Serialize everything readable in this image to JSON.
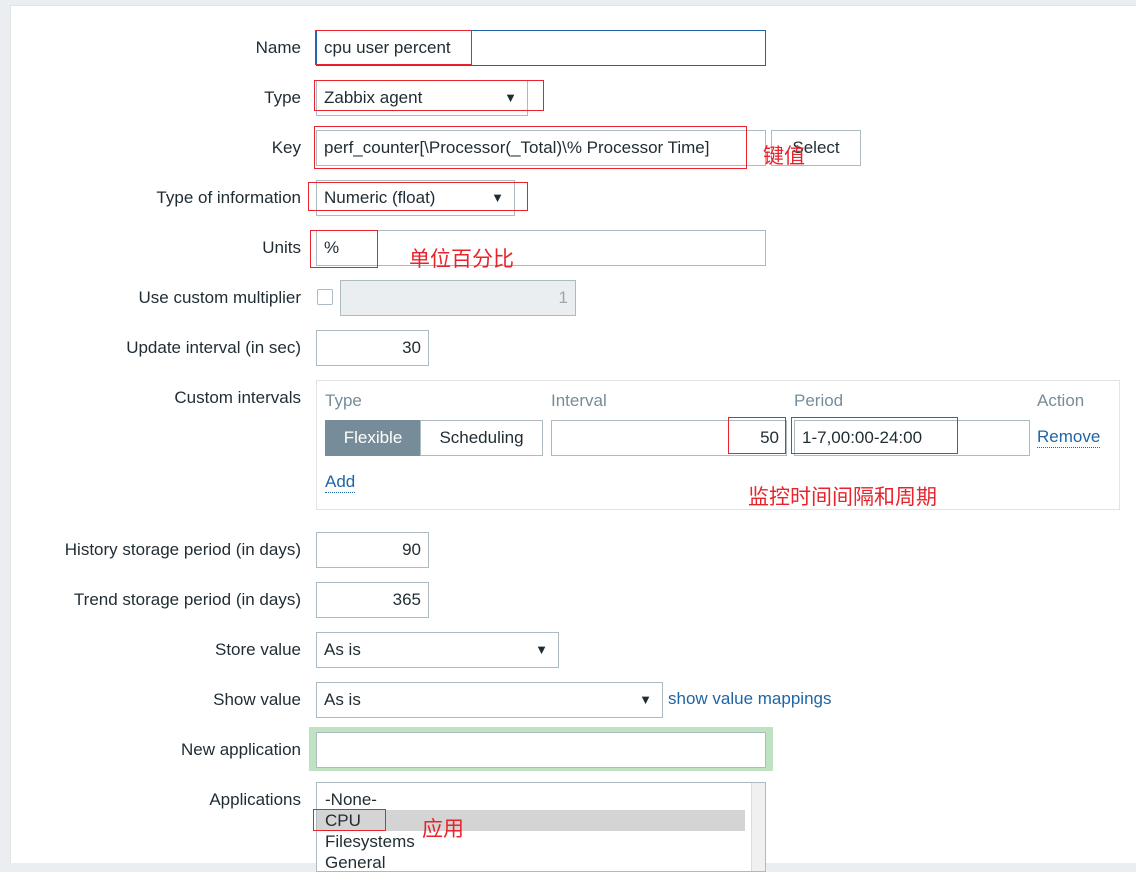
{
  "form": {
    "name": {
      "label": "Name",
      "value": "cpu user percent"
    },
    "type": {
      "label": "Type",
      "value": "Zabbix agent"
    },
    "key": {
      "label": "Key",
      "value": "perf_counter[\\Processor(_Total)\\% Processor Time]",
      "select_label": "Select"
    },
    "type_of_information": {
      "label": "Type of information",
      "value": "Numeric (float)"
    },
    "units": {
      "label": "Units",
      "value": "%"
    },
    "custom_multiplier": {
      "label": "Use custom multiplier",
      "checked": false,
      "value": "1"
    },
    "update_interval": {
      "label": "Update interval (in sec)",
      "value": "30"
    },
    "custom_intervals": {
      "label": "Custom intervals",
      "headers": {
        "type": "Type",
        "interval": "Interval",
        "period": "Period",
        "action": "Action"
      },
      "row": {
        "type_options": [
          "Flexible",
          "Scheduling"
        ],
        "selected_type": "Flexible",
        "interval": "50",
        "period": "1-7,00:00-24:00",
        "remove_label": "Remove"
      },
      "add_label": "Add"
    },
    "history": {
      "label": "History storage period (in days)",
      "value": "90"
    },
    "trends": {
      "label": "Trend storage period (in days)",
      "value": "365"
    },
    "store_value": {
      "label": "Store value",
      "value": "As is"
    },
    "show_value": {
      "label": "Show value",
      "value": "As is",
      "mappings_link": "show value mappings"
    },
    "new_application": {
      "label": "New application",
      "value": ""
    },
    "applications": {
      "label": "Applications",
      "options": [
        "-None-",
        "CPU",
        "Filesystems",
        "General"
      ],
      "selected": "CPU"
    }
  },
  "annotations": {
    "key": "键值",
    "units": "单位百分比",
    "intervals": "监控时间间隔和周期",
    "applications": "应用"
  },
  "colors": {
    "accent": "#1f65a5",
    "annotation": "#e8232b",
    "focus_green": "#bfe3c2"
  }
}
